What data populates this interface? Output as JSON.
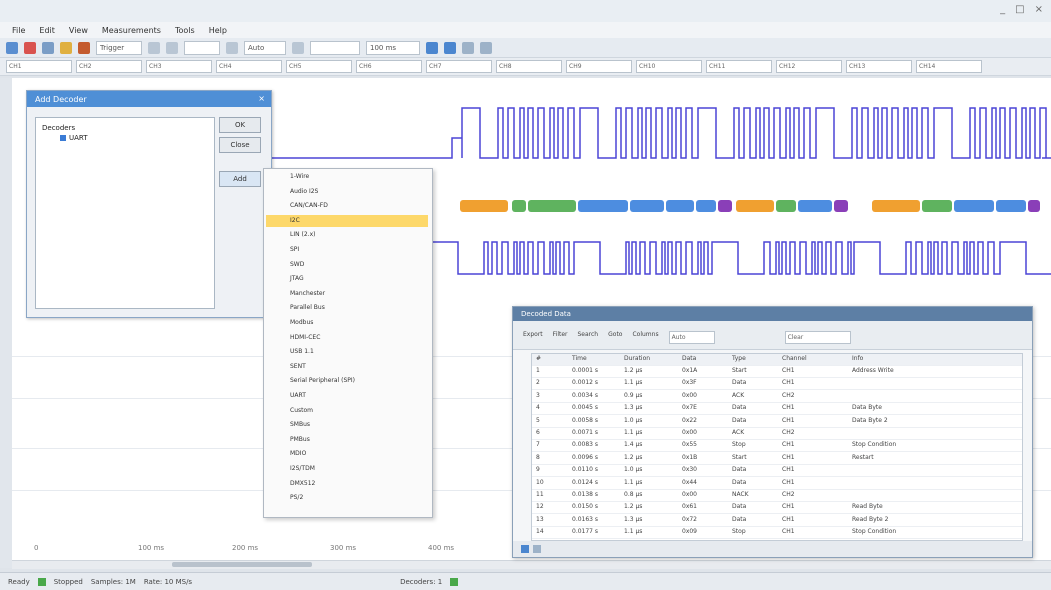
{
  "window": {
    "title": "",
    "controls": [
      "_",
      "□",
      "×"
    ]
  },
  "menu": [
    "File",
    "Edit",
    "View",
    "Measurements",
    "Tools",
    "Help"
  ],
  "toolbar": {
    "fields": [
      "Trigger",
      "",
      "Auto",
      "",
      "100 ms"
    ]
  },
  "toolbar2": {
    "channels": [
      "CH1",
      "CH2",
      "CH3",
      "CH4",
      "CH5",
      "CH6",
      "CH7",
      "CH8",
      "CH9",
      "CH10",
      "CH11",
      "CH12",
      "CH13",
      "CH14"
    ]
  },
  "dialog": {
    "title": "Add Decoder",
    "close": "×",
    "tree_root": "Decoders",
    "tree_child": "UART",
    "buttons": {
      "ok": "OK",
      "cancel": "Close",
      "add": "Add"
    }
  },
  "dropdown_items": [
    "1-Wire",
    "Audio I2S",
    "CAN/CAN-FD",
    "I2C",
    "LIN (2.x)",
    "SPI",
    "SWD",
    "JTAG",
    "Manchester",
    "Parallel Bus",
    "Modbus",
    "HDMI-CEC",
    "USB 1.1",
    "SENT",
    "Serial Peripheral (SPI)",
    "UART",
    "Custom",
    "SMBus",
    "PMBus",
    "MDIO",
    "I2S/TDM",
    "DMX512",
    "PS/2"
  ],
  "dropdown_highlight_index": 3,
  "time_ticks": [
    "0",
    "100 ms",
    "200 ms",
    "300 ms",
    "400 ms"
  ],
  "panel": {
    "title": "Decoded Data",
    "toolbar_items": [
      "Export",
      "Filter",
      "Search",
      "Goto",
      "Columns",
      "Auto",
      "Clear"
    ],
    "columns": [
      "#",
      "Time",
      "Duration",
      "Data",
      "Type",
      "Channel",
      "Info"
    ],
    "rows": [
      [
        "1",
        "0.0001 s",
        "1.2 µs",
        "0x1A",
        "Start",
        "CH1",
        "Address Write"
      ],
      [
        "2",
        "0.0012 s",
        "1.1 µs",
        "0x3F",
        "Data",
        "CH1",
        ""
      ],
      [
        "3",
        "0.0034 s",
        "0.9 µs",
        "0x00",
        "ACK",
        "CH2",
        ""
      ],
      [
        "4",
        "0.0045 s",
        "1.3 µs",
        "0x7E",
        "Data",
        "CH1",
        "Data Byte"
      ],
      [
        "5",
        "0.0058 s",
        "1.0 µs",
        "0x22",
        "Data",
        "CH1",
        "Data Byte 2"
      ],
      [
        "6",
        "0.0071 s",
        "1.1 µs",
        "0x00",
        "ACK",
        "CH2",
        ""
      ],
      [
        "7",
        "0.0083 s",
        "1.4 µs",
        "0x55",
        "Stop",
        "CH1",
        "Stop Condition"
      ],
      [
        "8",
        "0.0096 s",
        "1.2 µs",
        "0x1B",
        "Start",
        "CH1",
        "Restart"
      ],
      [
        "9",
        "0.0110 s",
        "1.0 µs",
        "0x30",
        "Data",
        "CH1",
        ""
      ],
      [
        "10",
        "0.0124 s",
        "1.1 µs",
        "0x44",
        "Data",
        "CH1",
        ""
      ],
      [
        "11",
        "0.0138 s",
        "0.8 µs",
        "0x00",
        "NACK",
        "CH2",
        ""
      ],
      [
        "12",
        "0.0150 s",
        "1.2 µs",
        "0x61",
        "Data",
        "CH1",
        "Read Byte"
      ],
      [
        "13",
        "0.0163 s",
        "1.3 µs",
        "0x72",
        "Data",
        "CH1",
        "Read Byte 2"
      ],
      [
        "14",
        "0.0177 s",
        "1.1 µs",
        "0x09",
        "Stop",
        "CH1",
        "Stop Condition"
      ]
    ]
  },
  "status": [
    "Ready",
    "Stopped",
    "Samples: 1M",
    "Rate: 10 MS/s",
    "Decoders: 1"
  ],
  "colors": {
    "wave": "#4b45d6",
    "dialog_title": "#4f8fd6",
    "highlight": "#fdd86a",
    "decode_orange": "#f0a030",
    "decode_green": "#5fb35f",
    "decode_blue": "#4d8de0",
    "decode_purple": "#8a3fb8"
  }
}
